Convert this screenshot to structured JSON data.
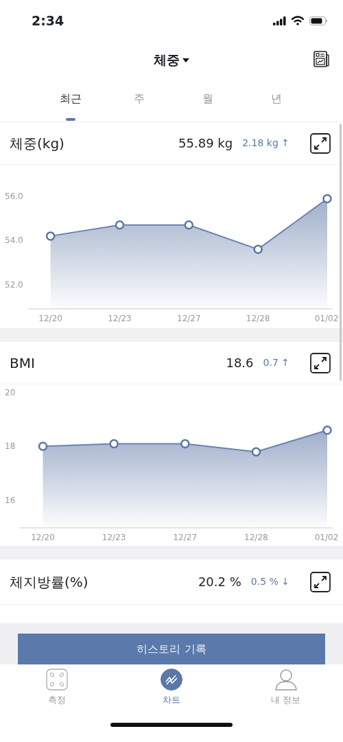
{
  "status_bar": {
    "time": "2:34"
  },
  "header": {
    "title": "체중"
  },
  "tabs": [
    {
      "label": "최근",
      "selected": true
    },
    {
      "label": "주",
      "selected": false
    },
    {
      "label": "월",
      "selected": false
    },
    {
      "label": "년",
      "selected": false
    }
  ],
  "cards": [
    {
      "title": "체중(kg)",
      "value": "55.89 kg",
      "change": "2.18 kg ↑",
      "chart_data": {
        "type": "area",
        "categories": [
          "12/20",
          "12/23",
          "12/27",
          "12/28",
          "01/02"
        ],
        "series": [
          {
            "color": "#6b83ae",
            "values": [
              54.2,
              54.7,
              54.7,
              53.6,
              55.89
            ]
          }
        ],
        "ylim": [
          50.9,
          56.0
        ],
        "yticks": [
          {
            "value": 52,
            "label": "52.0"
          },
          {
            "value": 54,
            "label": "54.0"
          },
          {
            "value": 56,
            "label": "56.0"
          }
        ]
      }
    },
    {
      "title": "BMI",
      "value": "18.6",
      "change": "0.7 ↑",
      "chart_data": {
        "type": "area",
        "categories": [
          "12/20",
          "12/23",
          "12/27",
          "12/28",
          "01/02"
        ],
        "series": [
          {
            "color": "#6b83ae",
            "values": [
              18.0,
              18.1,
              18.1,
              17.8,
              18.6
            ]
          }
        ],
        "ylim": [
          14.97,
          20
        ],
        "yticks": [
          {
            "value": 16,
            "label": "16"
          },
          {
            "value": 18,
            "label": "18"
          },
          {
            "value": 20,
            "label": "20"
          }
        ]
      }
    },
    {
      "title": "체지방률(%)",
      "value": "20.2 %",
      "change": "0.5 % ↓"
    }
  ],
  "history_button": {
    "label": "히스토리 기록"
  },
  "bottom_nav": [
    {
      "label": "측정",
      "selected": false
    },
    {
      "label": "차트",
      "selected": true
    },
    {
      "label": "내 정보",
      "selected": false
    }
  ]
}
